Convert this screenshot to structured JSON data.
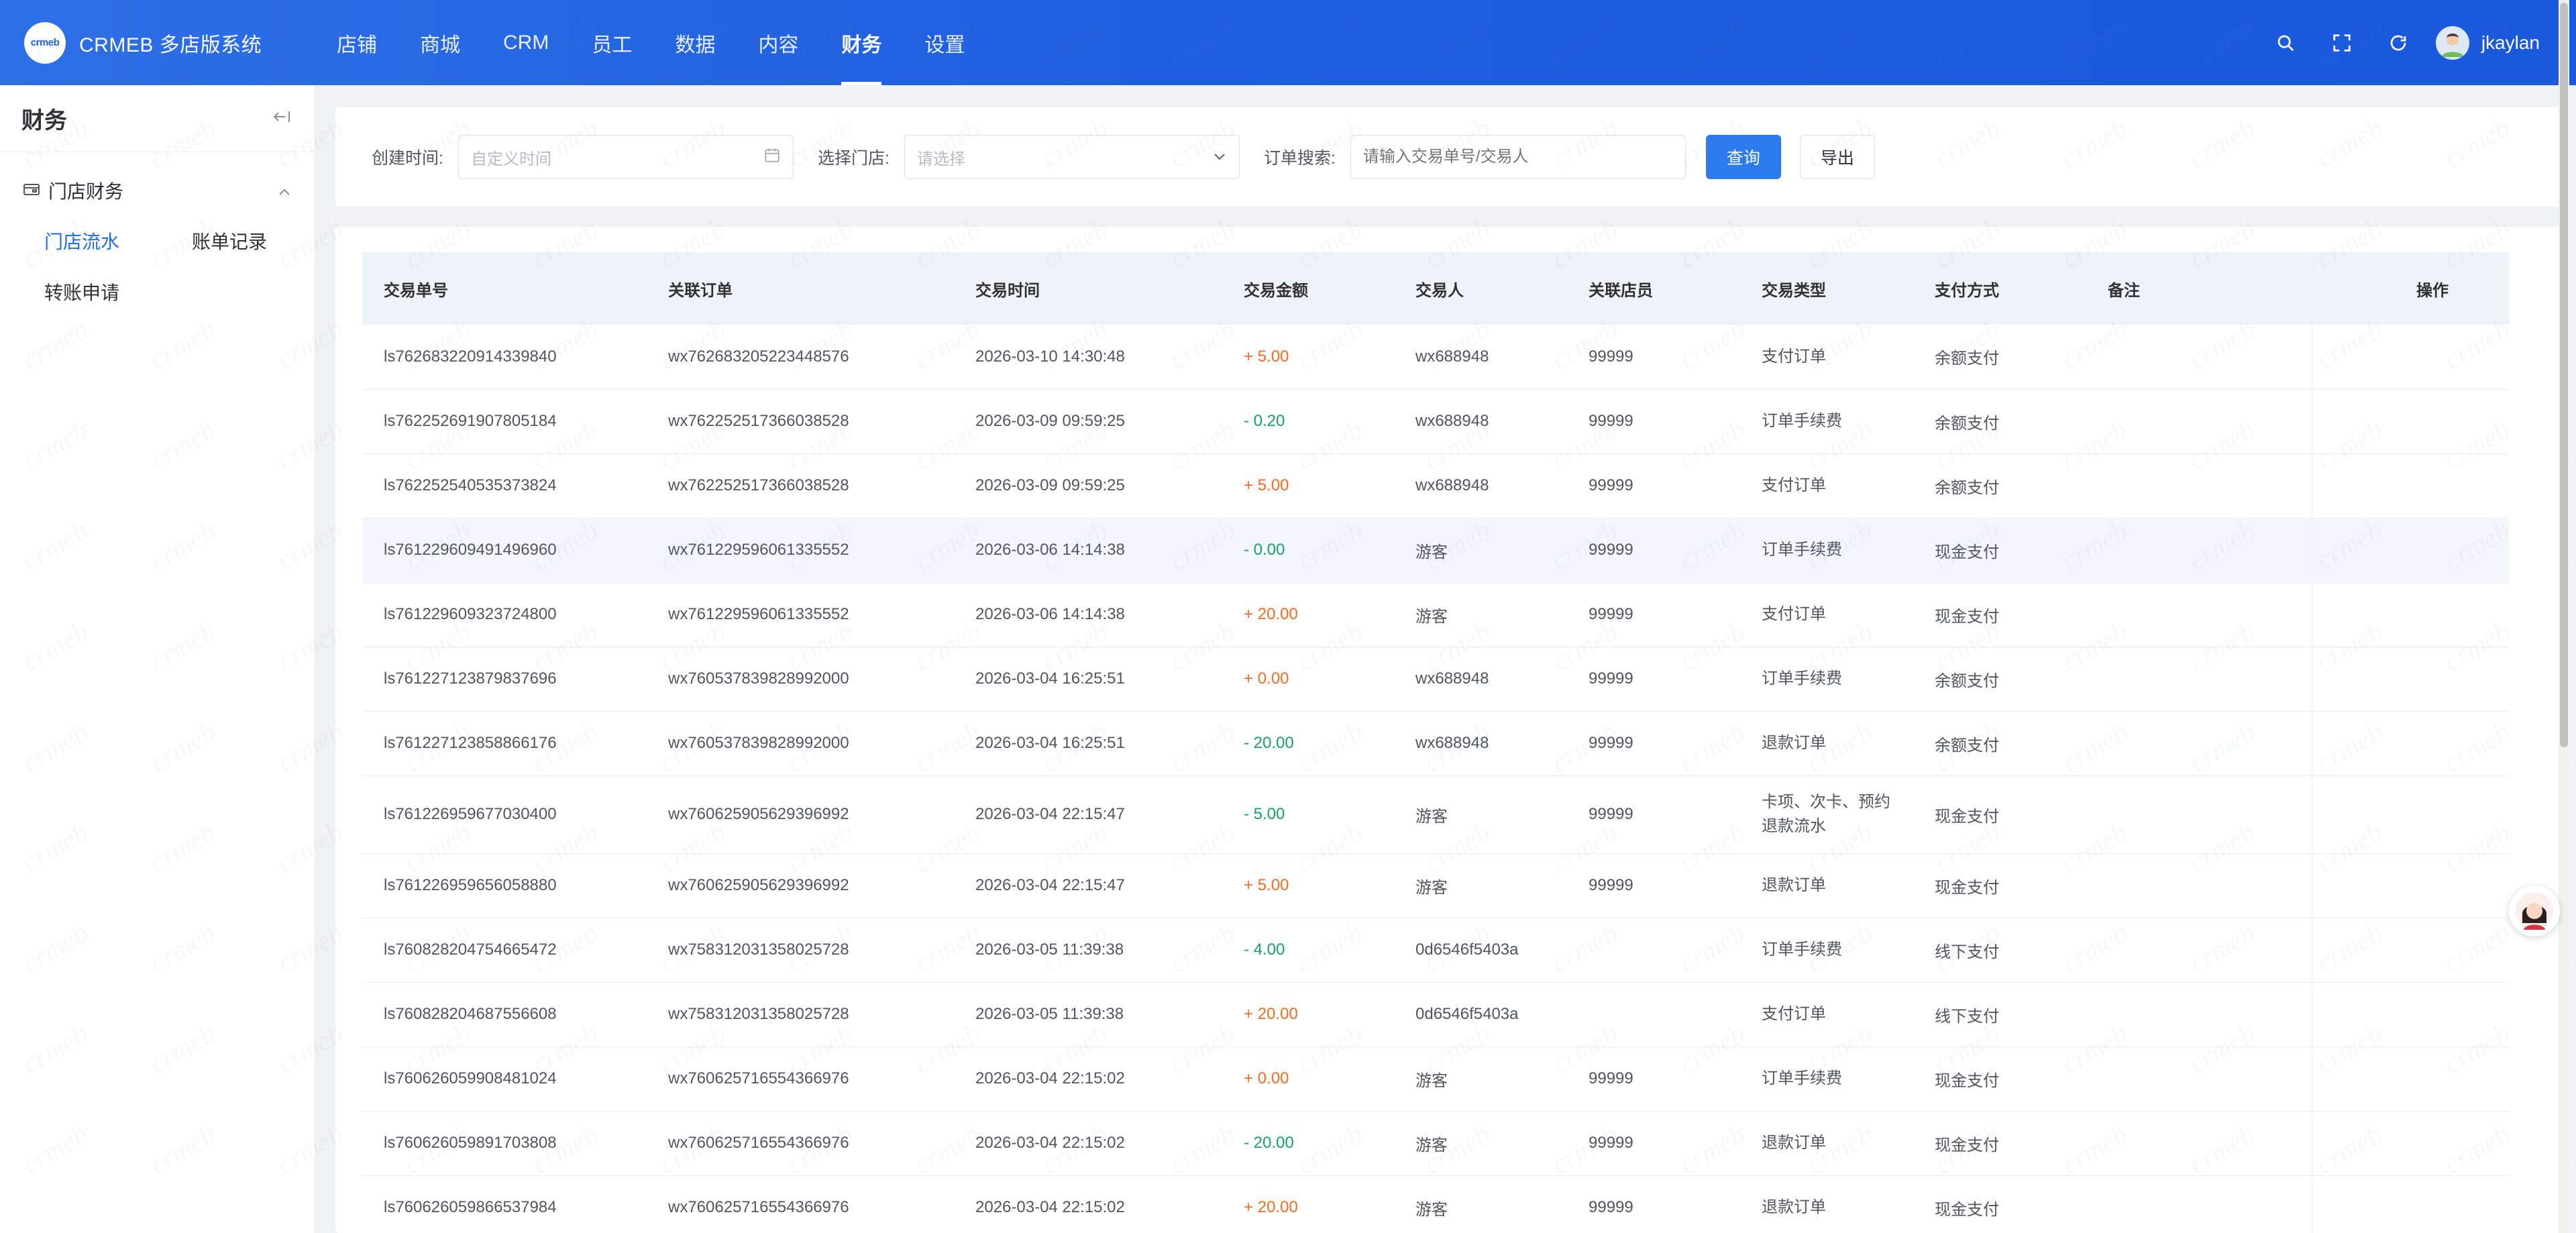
{
  "app": {
    "logo_text": "crmeb",
    "title": "CRMEB 多店版系统"
  },
  "nav": {
    "items": [
      {
        "label": "店铺"
      },
      {
        "label": "商城"
      },
      {
        "label": "CRM"
      },
      {
        "label": "员工"
      },
      {
        "label": "数据"
      },
      {
        "label": "内容"
      },
      {
        "label": "财务",
        "active": true
      },
      {
        "label": "设置"
      }
    ]
  },
  "header": {
    "user_name": "jkaylan",
    "icons": [
      "search-icon",
      "fullscreen-icon",
      "refresh-icon"
    ]
  },
  "sidebar": {
    "title": "财务",
    "group_label": "门店财务",
    "links": [
      {
        "label": "门店流水",
        "active": true
      },
      {
        "label": "账单记录"
      },
      {
        "label": "转账申请"
      }
    ]
  },
  "filters": {
    "created_time_label": "创建时间:",
    "created_time_placeholder": "自定义时间",
    "store_label": "选择门店:",
    "store_placeholder": "请选择",
    "search_label": "订单搜索:",
    "search_placeholder": "请输入交易单号/交易人",
    "query_button": "查询",
    "export_button": "导出"
  },
  "table": {
    "columns": [
      "交易单号",
      "关联订单",
      "交易时间",
      "交易金额",
      "交易人",
      "关联店员",
      "交易类型",
      "支付方式",
      "备注",
      "操作"
    ],
    "rows": [
      {
        "id": "ls762683220914339840",
        "order": "wx762683205223448576",
        "time": "2026-03-10 14:30:48",
        "amount": "+ 5.00",
        "sign": "plus",
        "person": "wx688948",
        "clerk": "99999",
        "type": "支付订单",
        "pay": "余额支付"
      },
      {
        "id": "ls762252691907805184",
        "order": "wx762252517366038528",
        "time": "2026-03-09 09:59:25",
        "amount": "- 0.20",
        "sign": "minus",
        "person": "wx688948",
        "clerk": "99999",
        "type": "订单手续费",
        "pay": "余额支付"
      },
      {
        "id": "ls762252540535373824",
        "order": "wx762252517366038528",
        "time": "2026-03-09 09:59:25",
        "amount": "+ 5.00",
        "sign": "plus",
        "person": "wx688948",
        "clerk": "99999",
        "type": "支付订单",
        "pay": "余额支付"
      },
      {
        "id": "ls761229609491496960",
        "order": "wx761229596061335552",
        "time": "2026-03-06 14:14:38",
        "amount": "- 0.00",
        "sign": "minus",
        "person": "游客",
        "clerk": "99999",
        "type": "订单手续费",
        "pay": "现金支付",
        "highlight": true
      },
      {
        "id": "ls761229609323724800",
        "order": "wx761229596061335552",
        "time": "2026-03-06 14:14:38",
        "amount": "+ 20.00",
        "sign": "plus",
        "person": "游客",
        "clerk": "99999",
        "type": "支付订单",
        "pay": "现金支付"
      },
      {
        "id": "ls761227123879837696",
        "order": "wx760537839828992000",
        "time": "2026-03-04 16:25:51",
        "amount": "+ 0.00",
        "sign": "plus",
        "person": "wx688948",
        "clerk": "99999",
        "type": "订单手续费",
        "pay": "余额支付"
      },
      {
        "id": "ls761227123858866176",
        "order": "wx760537839828992000",
        "time": "2026-03-04 16:25:51",
        "amount": "- 20.00",
        "sign": "minus",
        "person": "wx688948",
        "clerk": "99999",
        "type": "退款订单",
        "pay": "余额支付"
      },
      {
        "id": "ls761226959677030400",
        "order": "wx760625905629396992",
        "time": "2026-03-04 22:15:47",
        "amount": "- 5.00",
        "sign": "minus",
        "person": "游客",
        "clerk": "99999",
        "type": "卡项、次卡、预约退款流水",
        "pay": "现金支付",
        "tall": true
      },
      {
        "id": "ls761226959656058880",
        "order": "wx760625905629396992",
        "time": "2026-03-04 22:15:47",
        "amount": "+ 5.00",
        "sign": "plus",
        "person": "游客",
        "clerk": "99999",
        "type": "退款订单",
        "pay": "现金支付"
      },
      {
        "id": "ls760828204754665472",
        "order": "wx758312031358025728",
        "time": "2026-03-05 11:39:38",
        "amount": "- 4.00",
        "sign": "minus",
        "person": "0d6546f5403a",
        "clerk": "",
        "type": "订单手续费",
        "pay": "线下支付"
      },
      {
        "id": "ls760828204687556608",
        "order": "wx758312031358025728",
        "time": "2026-03-05 11:39:38",
        "amount": "+ 20.00",
        "sign": "plus",
        "person": "0d6546f5403a",
        "clerk": "",
        "type": "支付订单",
        "pay": "线下支付"
      },
      {
        "id": "ls760626059908481024",
        "order": "wx760625716554366976",
        "time": "2026-03-04 22:15:02",
        "amount": "+ 0.00",
        "sign": "plus",
        "person": "游客",
        "clerk": "99999",
        "type": "订单手续费",
        "pay": "现金支付"
      },
      {
        "id": "ls760626059891703808",
        "order": "wx760625716554366976",
        "time": "2026-03-04 22:15:02",
        "amount": "- 20.00",
        "sign": "minus",
        "person": "游客",
        "clerk": "99999",
        "type": "退款订单",
        "pay": "现金支付"
      },
      {
        "id": "ls760626059866537984",
        "order": "wx760625716554366976",
        "time": "2026-03-04 22:15:02",
        "amount": "+ 20.00",
        "sign": "plus",
        "person": "游客",
        "clerk": "99999",
        "type": "退款订单",
        "pay": "现金支付"
      }
    ]
  },
  "colors": {
    "brand": "#1f5ee0",
    "accent": "#2c7cf0",
    "positive": "#ff6a21",
    "negative": "#17a06b"
  }
}
